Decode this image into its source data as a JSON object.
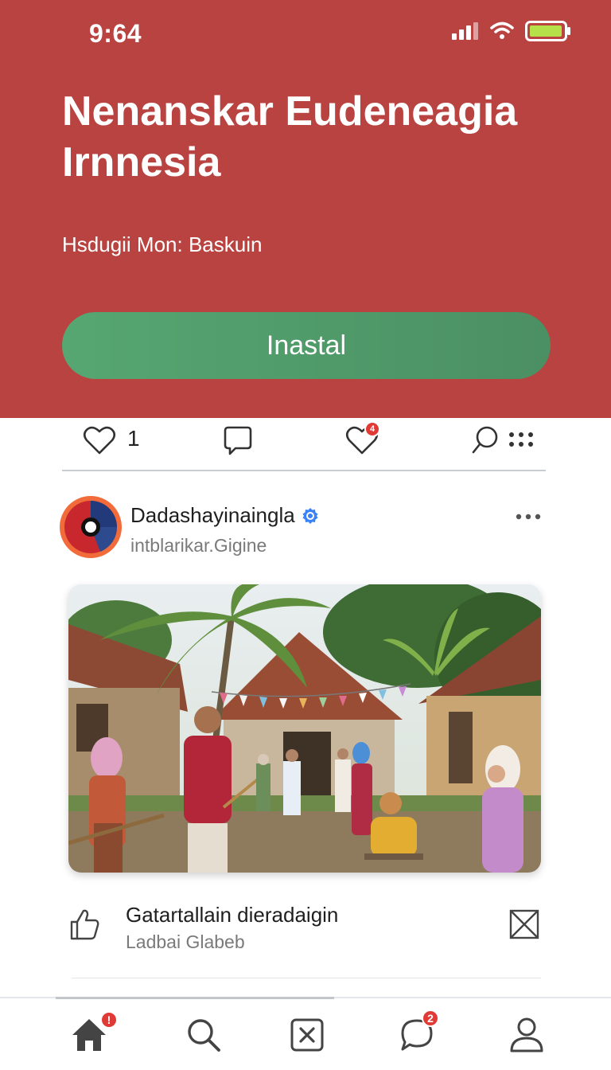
{
  "status_bar": {
    "time": "9:64"
  },
  "hero": {
    "title": "Nenanskar Eudeneagia Irnnesia",
    "subtitle": "Hsdugii Mon: Baskuin",
    "install_label": "Inastal"
  },
  "actions": {
    "like_count": "1",
    "notification_badge": "4"
  },
  "post": {
    "author": "Dadashayinaingla",
    "handle": "intblarikar.Gigine",
    "verified": true,
    "caption_title": "Gatartallain dieradaigin",
    "caption_sub": "Ladbai Glabeb"
  },
  "bottom_nav": {
    "items": [
      "home",
      "search",
      "close-box",
      "chat",
      "profile"
    ],
    "home_badge": "!",
    "chat_badge": "2"
  },
  "colors": {
    "hero_bg": "#b94340",
    "install_btn": "#56a772",
    "verified": "#3b82f6",
    "badge": "#e03a36"
  }
}
